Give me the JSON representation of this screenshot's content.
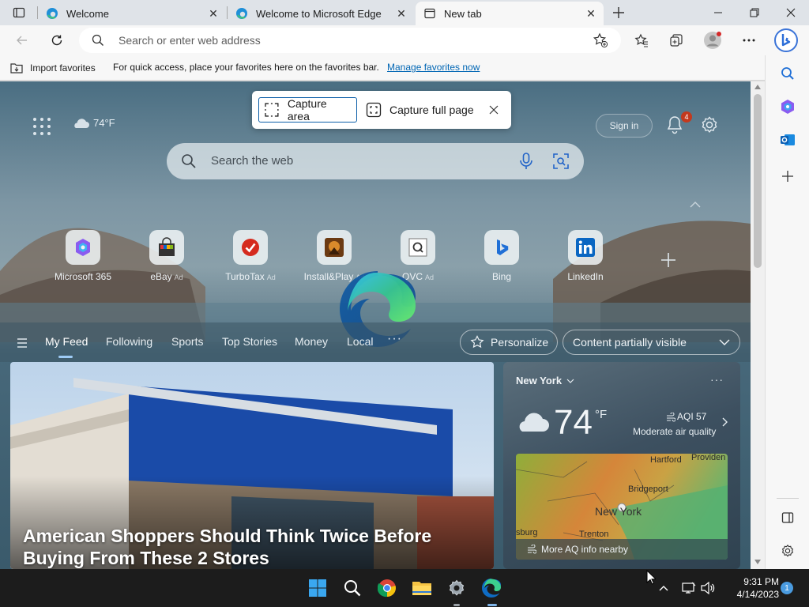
{
  "tabs": [
    {
      "title": "Welcome",
      "active": false
    },
    {
      "title": "Welcome to Microsoft Edge",
      "active": false
    },
    {
      "title": "New tab",
      "active": true
    }
  ],
  "address_bar": {
    "placeholder": "Search or enter web address"
  },
  "favorites_bar": {
    "import_label": "Import favorites",
    "message": "For quick access, place your favorites here on the favorites bar.",
    "link": "Manage favorites now"
  },
  "screenshot_tool": {
    "capture_area": "Capture area",
    "capture_full_page": "Capture full page"
  },
  "ntp": {
    "weather_temp": "74°F",
    "sign_in": "Sign in",
    "notification_count": "4",
    "search_placeholder": "Search the web",
    "quick_links": [
      {
        "label": "Microsoft 365",
        "ad": ""
      },
      {
        "label": "eBay",
        "ad": "Ad"
      },
      {
        "label": "TurboTax",
        "ad": "Ad"
      },
      {
        "label": "Install&Play",
        "ad": "Ad"
      },
      {
        "label": "QVC",
        "ad": "Ad"
      },
      {
        "label": "Bing",
        "ad": ""
      },
      {
        "label": "LinkedIn",
        "ad": ""
      }
    ],
    "feed_tabs": [
      "My Feed",
      "Following",
      "Sports",
      "Top Stories",
      "Money",
      "Local"
    ],
    "personalize": "Personalize",
    "content_visibility": "Content partially visible"
  },
  "hero": {
    "headline": "American Shoppers Should Think Twice Before Buying From These 2 Stores"
  },
  "weather_card": {
    "city": "New York",
    "temp": "74",
    "unit": "°F",
    "aqi": "AQI 57",
    "air_quality": "Moderate air quality",
    "map_labels": [
      "Hartford",
      "Providen",
      "Bridgeport",
      "New York",
      "sburg",
      "Trenton"
    ],
    "more_aq": "More AQ info nearby"
  },
  "taskbar": {
    "time": "9:31 PM",
    "date": "4/14/2023",
    "notifications": "1"
  },
  "colors": {
    "accent": "#0b5ea8",
    "link": "#0066b4",
    "badge": "#c4391d",
    "taskbar": "#1c1c1c"
  }
}
